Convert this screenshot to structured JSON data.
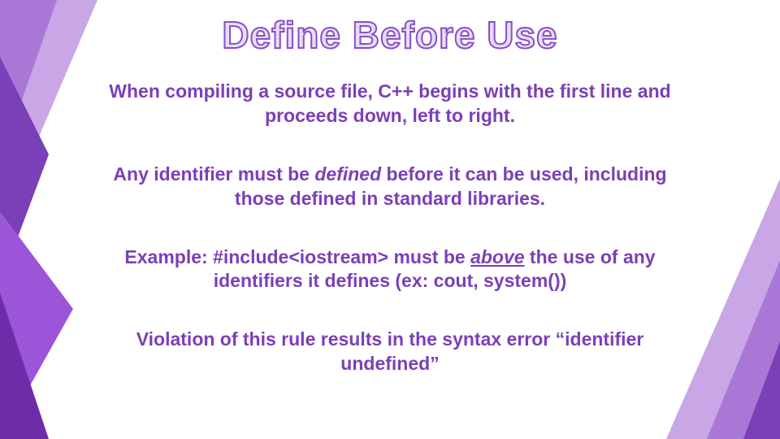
{
  "title": "Define Before Use",
  "paragraphs": {
    "p1": "When compiling a source file, C++ begins with the first line and proceeds down, left to right.",
    "p2_pre": "Any identifier must be ",
    "p2_em": "defined",
    "p2_post": " before it can be used, including those defined in standard libraries.",
    "p3_pre": "Example: #include<iostream> must be ",
    "p3_u": "above",
    "p3_post": " the use of any identifiers it defines (ex: cout, system())",
    "p4": "Violation of this rule results in the syntax error “identifier undefined”"
  }
}
